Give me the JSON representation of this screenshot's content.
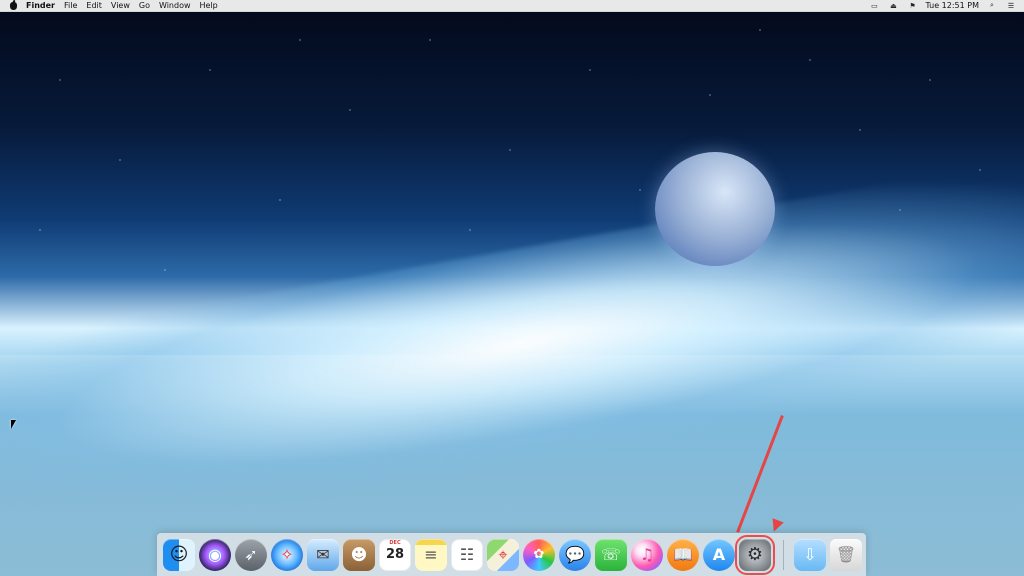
{
  "menubar": {
    "left_items": [
      "Finder",
      "File",
      "Edit",
      "View",
      "Go",
      "Window",
      "Help"
    ],
    "right_time": "Tue 12:51 PM"
  },
  "dock": {
    "calendar_month": "DEC",
    "calendar_day": "28"
  },
  "colors": {
    "dock_bg": "#E1E5E8",
    "highlight": "#EF4B4B",
    "menubar_bg": "#F0F0F0"
  }
}
